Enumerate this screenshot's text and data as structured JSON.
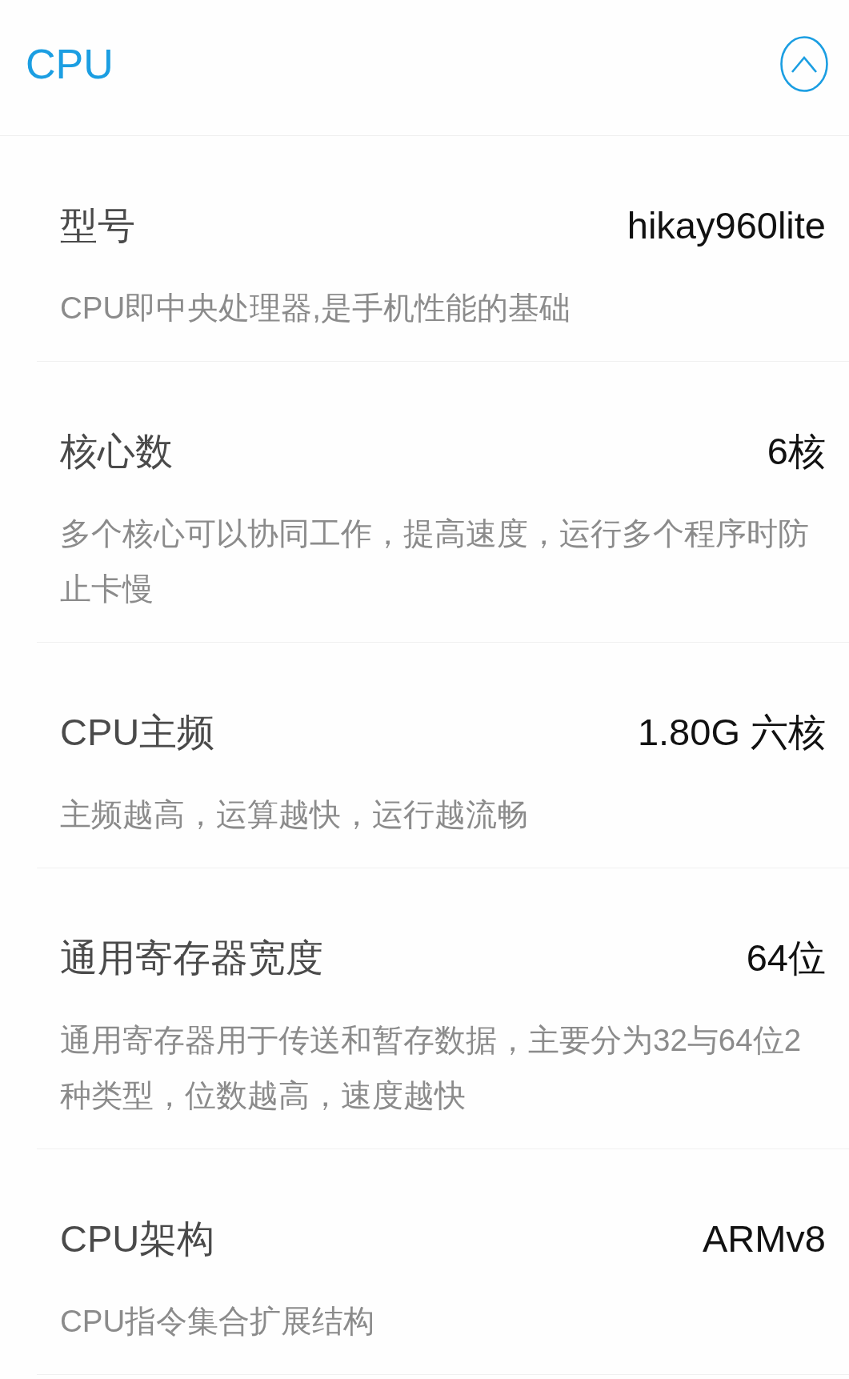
{
  "section": {
    "title": "CPU",
    "expanded": true
  },
  "rows": [
    {
      "label": "型号",
      "value": "hikay960lite",
      "description": "CPU即中央处理器,是手机性能的基础"
    },
    {
      "label": "核心数",
      "value": "6核",
      "description": "多个核心可以协同工作，提高速度，运行多个程序时防止卡慢"
    },
    {
      "label": "CPU主频",
      "value": "1.80G 六核",
      "description": "主频越高，运算越快，运行越流畅"
    },
    {
      "label": "通用寄存器宽度",
      "value": "64位",
      "description": "通用寄存器用于传送和暂存数据，主要分为32与64位2种类型，位数越高，速度越快"
    },
    {
      "label": "CPU架构",
      "value": "ARMv8",
      "description": "CPU指令集合扩展结构"
    }
  ]
}
